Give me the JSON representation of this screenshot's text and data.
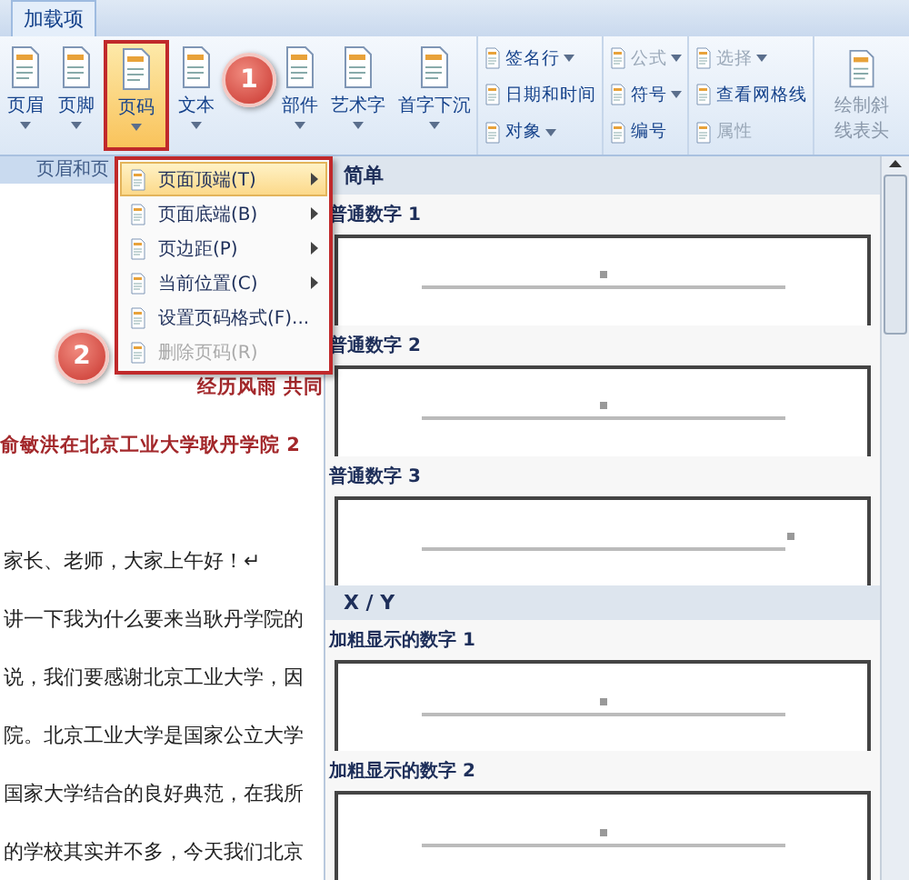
{
  "tab": {
    "label": "加载项"
  },
  "ribbon": {
    "large_buttons": [
      {
        "label": "页眉",
        "selected": false,
        "disabled": false
      },
      {
        "label": "页脚",
        "selected": false,
        "disabled": false
      },
      {
        "label": "页码",
        "selected": true,
        "disabled": false
      },
      {
        "label": "文本",
        "selected": false,
        "disabled": false
      },
      {
        "label": "部件",
        "selected": false,
        "disabled": false
      },
      {
        "label": "艺术字",
        "selected": false,
        "disabled": false
      },
      {
        "label": "首字下沉",
        "selected": false,
        "disabled": false
      }
    ],
    "small_columns": [
      [
        {
          "label": "签名行",
          "dropdown": true,
          "disabled": false
        },
        {
          "label": "日期和时间",
          "dropdown": false,
          "disabled": false
        },
        {
          "label": "对象",
          "dropdown": true,
          "disabled": false
        }
      ],
      [
        {
          "label": "公式",
          "dropdown": true,
          "disabled": true
        },
        {
          "label": "符号",
          "dropdown": true,
          "disabled": false
        },
        {
          "label": "编号",
          "dropdown": false,
          "disabled": false
        }
      ],
      [
        {
          "label": "选择",
          "dropdown": true,
          "disabled": true
        },
        {
          "label": "查看网格线",
          "dropdown": false,
          "disabled": false
        },
        {
          "label": "属性",
          "dropdown": false,
          "disabled": true
        }
      ]
    ],
    "table_button": {
      "label": "绘制斜线表头",
      "disabled": true
    },
    "group_label": "页眉和页"
  },
  "menu": {
    "items": [
      {
        "label": "页面顶端(T)",
        "submenu": true,
        "disabled": false,
        "selected": true
      },
      {
        "label": "页面底端(B)",
        "submenu": true,
        "disabled": false,
        "selected": false
      },
      {
        "label": "页边距(P)",
        "submenu": true,
        "disabled": false,
        "selected": false
      },
      {
        "label": "当前位置(C)",
        "submenu": true,
        "disabled": false,
        "selected": false
      },
      {
        "label": "设置页码格式(F)...",
        "submenu": false,
        "disabled": false,
        "selected": false
      },
      {
        "label": "删除页码(R)",
        "submenu": false,
        "disabled": true,
        "selected": false
      }
    ]
  },
  "gallery": {
    "sections": [
      {
        "header": "简单",
        "items": [
          {
            "title": "普通数字 1",
            "kind": "centered"
          },
          {
            "title": "普通数字 2",
            "kind": "centered"
          },
          {
            "title": "普通数字 3",
            "kind": "right"
          }
        ]
      },
      {
        "header": "X / Y",
        "items": [
          {
            "title": "加粗显示的数字 1",
            "kind": "centered"
          },
          {
            "title": "加粗显示的数字 2",
            "kind": "centered"
          }
        ]
      }
    ]
  },
  "document": {
    "lines": [
      {
        "text": "经历风雨 共同",
        "kind": "title"
      },
      {
        "text": "俞敏洪在北京工业大学耿丹学院 2",
        "kind": "subtitle"
      },
      {
        "kind": "blank"
      },
      {
        "text": "家长、老师，大家上午好！↵",
        "kind": "body"
      },
      {
        "text": "讲一下我为什么要来当耿丹学院的",
        "kind": "body"
      },
      {
        "text": "说，我们要感谢北京工业大学，因",
        "kind": "body"
      },
      {
        "text": "院。北京工业大学是国家公立大学",
        "kind": "body"
      },
      {
        "text": "国家大学结合的良好典范，在我所",
        "kind": "body"
      },
      {
        "text": "的学校其实并不多，今天我们北京",
        "kind": "body"
      }
    ]
  },
  "callouts": [
    {
      "label": "1"
    },
    {
      "label": "2"
    }
  ]
}
